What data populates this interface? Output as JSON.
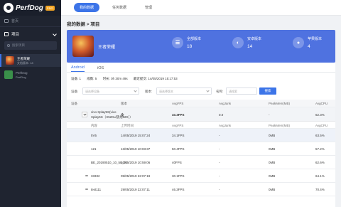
{
  "app": {
    "name": "PerfDog",
    "badge": "PRO"
  },
  "sidebar": {
    "home_label": "首页",
    "project_label": "项目",
    "search_placeholder": "搜索项目",
    "projects": [
      {
        "name": "王者荣耀",
        "sub": "文档版本: 18"
      },
      {
        "name": "PerfDog",
        "sub": "PerfDog"
      }
    ]
  },
  "topnav": {
    "tabs": [
      "我的数据",
      "任务数据",
      "管理"
    ]
  },
  "breadcrumb": "我的数据 > 项目",
  "banner": {
    "game_name": "王者荣耀",
    "stats": [
      {
        "icon": "list-icon",
        "glyph": "☰",
        "label": "全部版本",
        "value": "18"
      },
      {
        "icon": "android-icon",
        "glyph": "◐",
        "label": "安卓版本",
        "value": "14"
      },
      {
        "icon": "apple-icon",
        "glyph": "●",
        "label": "苹果版本",
        "value": "4"
      }
    ]
  },
  "platform_tabs": [
    "Android",
    "iOS"
  ],
  "summary": {
    "devices": "设备: 1",
    "count": "成数: 5",
    "duration": "时长: 0h 30m 49s",
    "last_upload": "最近提交: 14/05/2019 15:17:53"
  },
  "filters": {
    "device_label": "设备:",
    "device_placeholder": "请选择设备",
    "version_label": "版本:",
    "version_placeholder": "请选择版本",
    "search_label": "名称:",
    "search_placeholder": "请搜索",
    "search_button": "搜索"
  },
  "table": {
    "headers": [
      "设备",
      "版本",
      "AvgFPS",
      "AvgJank",
      "PeakMem(MB)",
      "AvgCPU"
    ],
    "group": {
      "device_line1": "vivo Xplay5S(vivo",
      "device_line2": "Xplay5S（X520L/骁龙820））",
      "version": "全",
      "avgfps": "40.3FPS",
      "avgjank": "0.0",
      "peakmem": "-",
      "avgcpu": "62.3%"
    },
    "subheaders": [
      "内容",
      "上传时间",
      "AvgFPS",
      "AvgJank",
      "PeakMem(MB)",
      "AvgCPU"
    ],
    "rows": [
      {
        "name": "5V5",
        "time": "14/05/2019 15:07:24",
        "fps": "34.1FPS",
        "jank": "-",
        "mem": "0MB",
        "cpu": "63.5%"
      },
      {
        "name": "121",
        "time": "13/05/2019 10:03:37",
        "fps": "50.4FPS",
        "jank": "-",
        "mem": "0MB",
        "cpu": "57.2%"
      },
      {
        "name": "BE_20190510_10_58_03",
        "time": "10/05/2019 10:59:06",
        "fps": "40FPS",
        "jank": "-",
        "mem": "0MB",
        "cpu": "62.6%"
      },
      {
        "name": "33332",
        "time": "09/05/2019 22:07:19",
        "fps": "30.1FPS",
        "jank": "-",
        "mem": "0MB",
        "cpu": "64.1%"
      },
      {
        "name": "test111",
        "time": "29/05/2019 22:07:11",
        "fps": "46.3FPS",
        "jank": "-",
        "mem": "0MB",
        "cpu": "70.4%"
      }
    ]
  },
  "colors": {
    "accent": "#3c74e8",
    "sidebar": "#1f2430",
    "banner": "#4f72e0"
  }
}
